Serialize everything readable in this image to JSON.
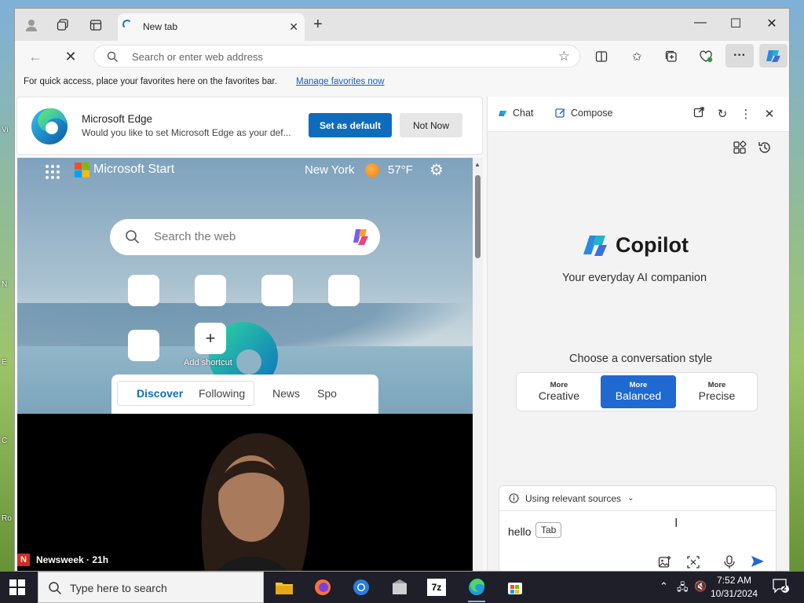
{
  "desktop": {
    "labels": [
      "Vi",
      "N",
      "E",
      "C",
      "Ro"
    ]
  },
  "browser": {
    "tab_title": "New tab",
    "address_placeholder": "Search or enter web address",
    "favorites_hint": "For quick access, place your favorites here on the favorites bar.",
    "favorites_link": "Manage favorites now"
  },
  "banner": {
    "title": "Microsoft Edge",
    "subtitle": "Would you like to set Microsoft Edge as your def...",
    "primary": "Set as default",
    "secondary": "Not Now"
  },
  "ntp": {
    "brand": "Microsoft Start",
    "city": "New York",
    "temp": "57°F",
    "search_placeholder": "Search the web",
    "add_shortcut": "Add shortcut",
    "feed_tabs": [
      "Discover",
      "Following",
      "News",
      "Spo"
    ],
    "news_source": "Newsweek · 21h",
    "news_logo_letter": "N"
  },
  "copilot": {
    "tabs": {
      "chat": "Chat",
      "compose": "Compose"
    },
    "title": "Copilot",
    "subtitle": "Your everyday AI companion",
    "style_prompt": "Choose a conversation style",
    "styles": [
      {
        "small": "More",
        "big": "Creative"
      },
      {
        "small": "More",
        "big": "Balanced"
      },
      {
        "small": "More",
        "big": "Precise"
      }
    ],
    "sources": "Using relevant sources",
    "input_value": "hello",
    "tab_hint": "Tab"
  },
  "taskbar": {
    "search_placeholder": "Type here to search",
    "time": "7:52 AM",
    "date": "10/31/2024",
    "notifications": "2",
    "app_7z": "7z"
  },
  "colors": {
    "accent": "#0f6cbd",
    "copilot_active": "#1f69d1"
  }
}
